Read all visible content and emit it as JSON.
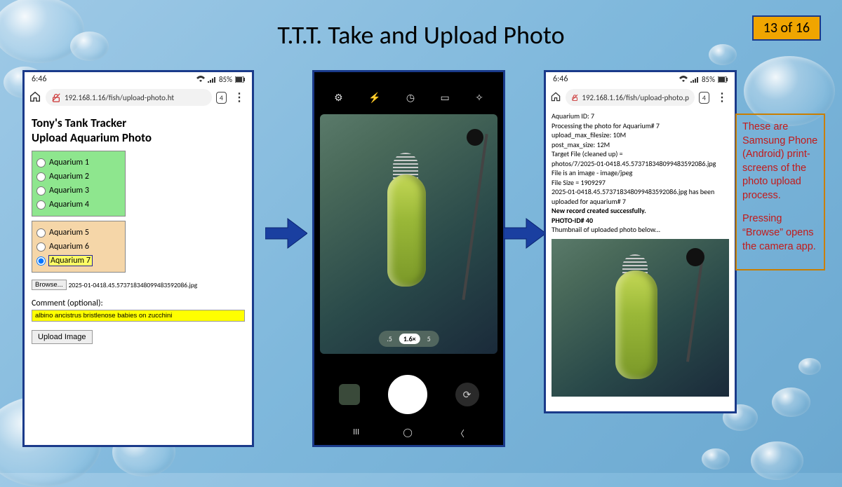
{
  "title": "T.T.T. Take and Upload Photo",
  "page_badge": "13 of 16",
  "note": {
    "p1": "These are Samsung Phone (Android) print-screens of the photo upload process.",
    "p2": "Pressing “Browse” opens the camera app."
  },
  "status": {
    "time": "6:46",
    "battery": "85%"
  },
  "address_bar": {
    "url_text": "192.168.1.16/fish/upload-photo.ht",
    "url_text_short": "192.168.1.16/fish/upload-photo.p",
    "tab_count": "4"
  },
  "phone1": {
    "h1": "Tony's Tank Tracker",
    "h2": "Upload Aquarium Photo",
    "aq_green": [
      "Aquarium 1",
      "Aquarium 2",
      "Aquarium 3",
      "Aquarium 4"
    ],
    "aq_orange": [
      "Aquarium 5",
      "Aquarium 6",
      "Aquarium 7"
    ],
    "selected_index": 6,
    "browse_label": "Browse...",
    "browse_filename": "2025-01-0418.45.573718348099483592086.jpg",
    "comment_label": "Comment (optional):",
    "comment_value": "albino ancistrus bristlenose babies on zucchini",
    "upload_label": "Upload Image"
  },
  "camera": {
    "zoom_left": ".5",
    "zoom_mid": "1.6×",
    "zoom_right": "5"
  },
  "phone3": {
    "lines": [
      "Aquarium ID: 7",
      "Processing the photo for Aquarium# 7",
      "upload_max_filesize: 10M",
      "post_max_size: 12M",
      "Target File (cleaned up) =",
      "photos/7/2025-01-0418.45.573718348099483592086.jpg",
      "File is an image - image/jpeg",
      "File Size = 1909297",
      "2025-01-0418.45.573718348099483592086.jpg has been uploaded for aquarium# 7"
    ],
    "bold1": "New record created successfully.",
    "bold2": "PHOTO-ID# 40",
    "thumb_label": "Thumbnail of uploaded photo below..."
  }
}
